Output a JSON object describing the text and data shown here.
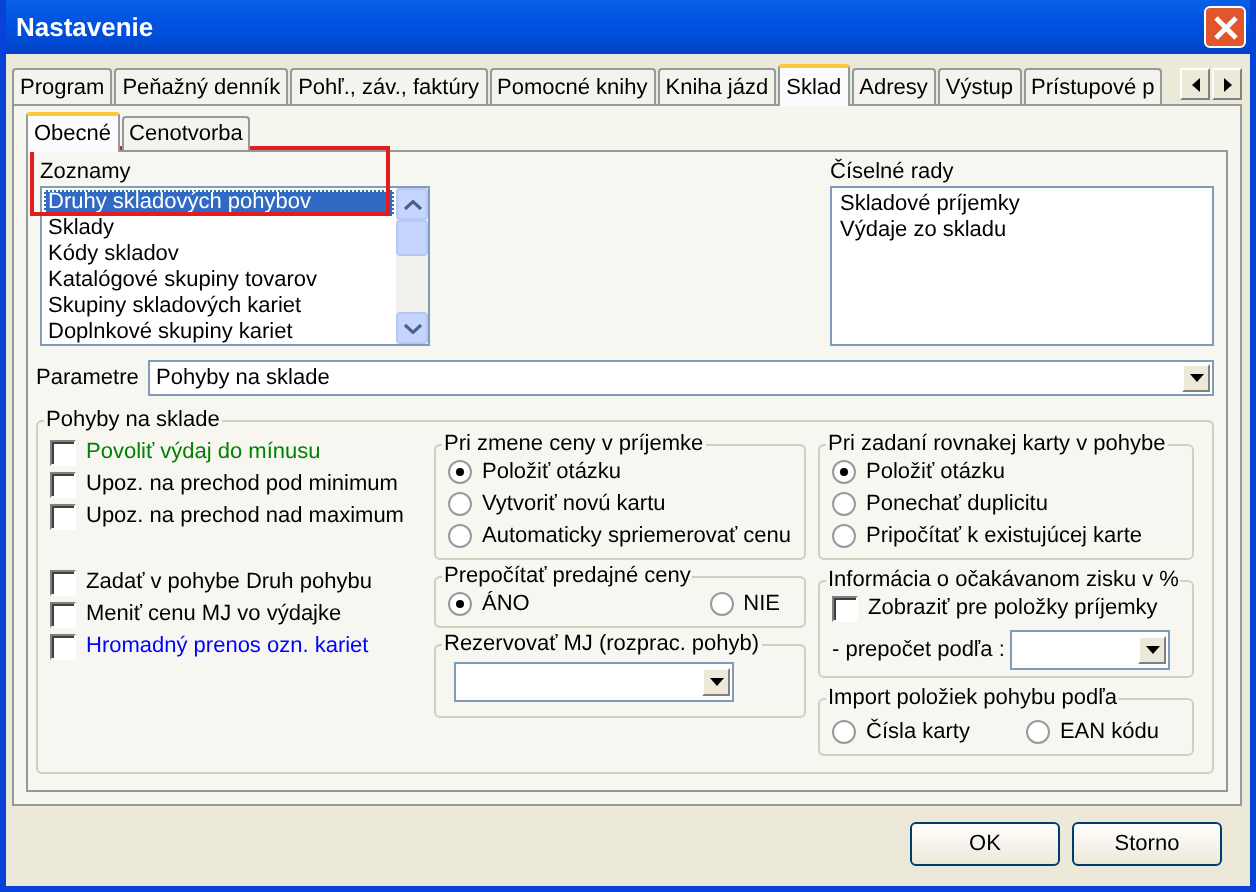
{
  "window": {
    "title": "Nastavenie"
  },
  "tabs": [
    {
      "label": "Program",
      "selected": false
    },
    {
      "label": "Peňažný denník",
      "selected": false
    },
    {
      "label": "Pohľ., záv., faktúry",
      "selected": false
    },
    {
      "label": "Pomocné knihy",
      "selected": false
    },
    {
      "label": "Kniha jázd",
      "selected": false
    },
    {
      "label": "Sklad",
      "selected": true
    },
    {
      "label": "Adresy",
      "selected": false
    },
    {
      "label": "Výstup",
      "selected": false
    },
    {
      "label": "Prístupové p",
      "selected": false
    }
  ],
  "subtabs": [
    {
      "label": "Obecné",
      "selected": true
    },
    {
      "label": "Cenotvorba",
      "selected": false
    }
  ],
  "lists": {
    "label": "Zoznamy",
    "highlighted": true,
    "items": [
      {
        "label": "Druhy skladových pohybov",
        "selected": true
      },
      {
        "label": "Sklady",
        "selected": false
      },
      {
        "label": "Kódy skladov",
        "selected": false
      },
      {
        "label": "Katalógové skupiny tovarov",
        "selected": false
      },
      {
        "label": "Skupiny skladových kariet",
        "selected": false
      },
      {
        "label": "Doplnkové skupiny kariet",
        "selected": false
      }
    ]
  },
  "number_series": {
    "label": "Číselné rady",
    "items": [
      {
        "label": "Skladové príjemky",
        "selected": false
      },
      {
        "label": "Výdaje zo skladu",
        "selected": false
      }
    ]
  },
  "parameters": {
    "label": "Parametre",
    "value": "Pohyby na sklade"
  },
  "group": {
    "title": "Pohyby na sklade",
    "checkbox_sets": [
      [
        {
          "label": "Povoliť výdaj do mínusu",
          "checked": false,
          "color": "#008000"
        },
        {
          "label": "Upoz. na prechod pod minimum",
          "checked": false,
          "color": "#000000"
        },
        {
          "label": "Upoz. na prechod nad maximum",
          "checked": false,
          "color": "#000000"
        }
      ],
      [
        {
          "label": "Zadať v pohybe Druh pohybu",
          "checked": false,
          "color": "#000000"
        },
        {
          "label": "Meniť cenu MJ vo výdajke",
          "checked": false,
          "color": "#000000"
        },
        {
          "label": "Hromadný prenos ozn. kariet",
          "checked": false,
          "color": "#0000ff"
        }
      ]
    ]
  },
  "price_change": {
    "title": "Pri zmene ceny v príjemke",
    "options": [
      {
        "label": "Položiť otázku",
        "selected": true
      },
      {
        "label": "Vytvoriť novú kartu",
        "selected": false
      },
      {
        "label": "Automaticky spriemerovať cenu",
        "selected": false
      }
    ]
  },
  "recalc_prices": {
    "title": "Prepočítať predajné ceny",
    "options": [
      {
        "label": "ÁNO",
        "selected": true
      },
      {
        "label": "NIE",
        "selected": false
      }
    ]
  },
  "reserve": {
    "title": "Rezervovať MJ (rozprac. pohyb)"
  },
  "same_card": {
    "title": "Pri zadaní rovnakej karty v pohybe",
    "options": [
      {
        "label": "Položiť otázku",
        "selected": true
      },
      {
        "label": "Ponechať duplicitu",
        "selected": false
      },
      {
        "label": "Pripočítať k existujúcej karte",
        "selected": false
      }
    ]
  },
  "profit_info": {
    "title": "Informácia o očakávanom zisku v %",
    "checkbox": {
      "label": "Zobraziť pre položky príjemky",
      "checked": false
    },
    "recalc_label": "- prepočet podľa :"
  },
  "import": {
    "title": "Import položiek pohybu podľa",
    "options": [
      {
        "label": "Čísla karty",
        "selected": false
      },
      {
        "label": "EAN kódu",
        "selected": false
      }
    ]
  },
  "buttons": [
    "OK",
    "Storno"
  ]
}
